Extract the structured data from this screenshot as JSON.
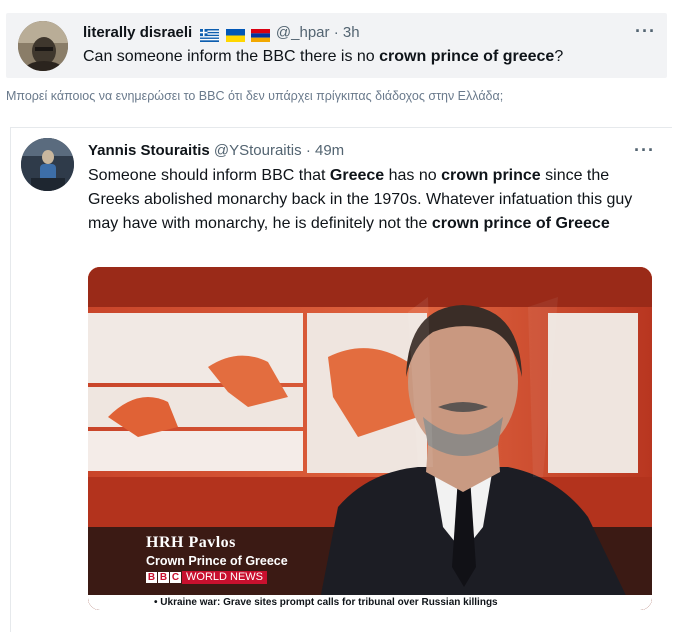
{
  "quote_tweet": {
    "display_name": "literally disraeli",
    "flags": [
      "greece-flag",
      "ukraine-flag",
      "armenia-flag"
    ],
    "handle": "@_hpar",
    "separator": "·",
    "time": "3h",
    "text_before": "Can someone inform the BBC there is no ",
    "text_bold": "crown prince of greece",
    "text_after": "?",
    "more_icon": "ellipsis-icon"
  },
  "translation": "Μπορεί κάποιος να ενημερώσει το BBC ότι δεν υπάρχει πρίγκιπας διάδοχος στην Ελλάδα;",
  "embedded_tweet": {
    "display_name": "Yannis Stouraitis",
    "handle": "@YStouraitis",
    "separator": "·",
    "time": "49m",
    "text": {
      "p1": "Someone should inform BBC that ",
      "b1": "Greece",
      "p2": " has no ",
      "b2": "crown prince",
      "p3": " since the Greeks abolished monarchy back in the 1970s. Whatever infatuation this guy may have with monarchy, he is definitely not the ",
      "b3": "crown prince of Greece"
    },
    "more_icon": "ellipsis-icon"
  },
  "media": {
    "lower_third_name": "HRH Pavlos",
    "lower_third_title": "Crown Prince of Greece",
    "channel_letters": [
      "B",
      "B",
      "C"
    ],
    "channel_name": "WORLD NEWS",
    "ticker": "• Ukraine war: Grave sites prompt calls for tribunal over Russian killings"
  },
  "colors": {
    "bbc_red": "#c8102e",
    "studio_red": "#d04a2b",
    "handle_gray": "#536471"
  }
}
